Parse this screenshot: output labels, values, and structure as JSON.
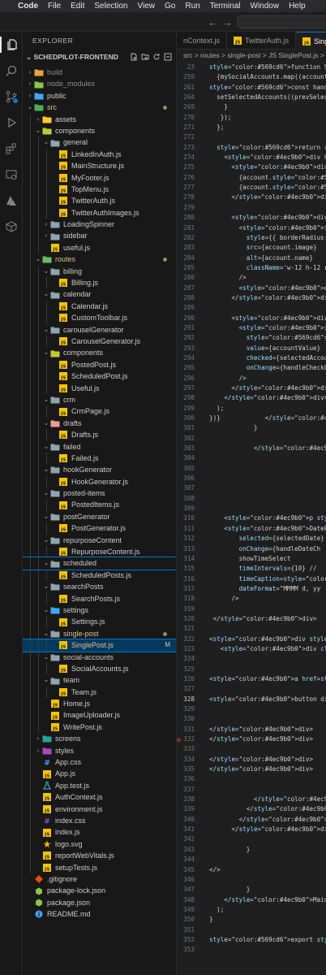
{
  "menubar": {
    "app": "Code",
    "items": [
      "File",
      "Edit",
      "Selection",
      "View",
      "Go",
      "Run",
      "Terminal",
      "Window",
      "Help"
    ]
  },
  "explorer": {
    "title": "EXPLORER",
    "root": "SCHEDPILOT-FRONTEND",
    "tree": [
      {
        "label": "build",
        "depth": 1,
        "type": "folder",
        "open": false,
        "dim": true,
        "icon": "folder-build",
        "color": "#e8a33d"
      },
      {
        "label": "node_modules",
        "depth": 1,
        "type": "folder",
        "open": false,
        "dim": true,
        "icon": "folder-node",
        "color": "#8bc34a"
      },
      {
        "label": "public",
        "depth": 1,
        "type": "folder",
        "open": false,
        "icon": "folder-public",
        "color": "#42a5f5"
      },
      {
        "label": "src",
        "depth": 1,
        "type": "folder",
        "open": true,
        "mod": true,
        "dot": true,
        "icon": "folder-src",
        "color": "#4caf50"
      },
      {
        "label": "assets",
        "depth": 2,
        "type": "folder",
        "open": false,
        "icon": "folder-assets",
        "color": "#ffca28"
      },
      {
        "label": "components",
        "depth": 2,
        "type": "folder",
        "open": true,
        "icon": "folder-components",
        "color": "#c0ca33"
      },
      {
        "label": "general",
        "depth": 3,
        "type": "folder",
        "open": true,
        "icon": "folder",
        "color": "#90a4ae"
      },
      {
        "label": "LinkedInAuth.js",
        "depth": 4,
        "type": "file",
        "icon": "js",
        "color": "#f5c400"
      },
      {
        "label": "MainStructure.js",
        "depth": 4,
        "type": "file",
        "icon": "js",
        "color": "#f5c400"
      },
      {
        "label": "MyFooter.js",
        "depth": 4,
        "type": "file",
        "icon": "js",
        "color": "#f5c400"
      },
      {
        "label": "TopMenu.js",
        "depth": 4,
        "type": "file",
        "icon": "js",
        "color": "#f5c400"
      },
      {
        "label": "TwitterAuth.js",
        "depth": 4,
        "type": "file",
        "icon": "js",
        "color": "#f5c400"
      },
      {
        "label": "TwitterAuthImages.js",
        "depth": 4,
        "type": "file",
        "icon": "js",
        "color": "#f5c400"
      },
      {
        "label": "LoadingSpinner",
        "depth": 3,
        "type": "folder",
        "open": false,
        "icon": "folder",
        "color": "#90a4ae"
      },
      {
        "label": "sidebar",
        "depth": 3,
        "type": "folder",
        "open": false,
        "icon": "folder",
        "color": "#90a4ae"
      },
      {
        "label": "useful.js",
        "depth": 3,
        "type": "file",
        "icon": "js",
        "color": "#f5c400"
      },
      {
        "label": "routes",
        "depth": 2,
        "type": "folder",
        "open": true,
        "mod": true,
        "dot": true,
        "icon": "folder-routes",
        "color": "#66bb6a"
      },
      {
        "label": "billing",
        "depth": 3,
        "type": "folder",
        "open": true,
        "icon": "folder",
        "color": "#90a4ae"
      },
      {
        "label": "Billing.js",
        "depth": 4,
        "type": "file",
        "icon": "js",
        "color": "#f5c400"
      },
      {
        "label": "calendar",
        "depth": 3,
        "type": "folder",
        "open": true,
        "icon": "folder",
        "color": "#90a4ae"
      },
      {
        "label": "Calendar.js",
        "depth": 4,
        "type": "file",
        "icon": "js",
        "color": "#f5c400"
      },
      {
        "label": "CustomToolbar.js",
        "depth": 4,
        "type": "file",
        "icon": "js",
        "color": "#f5c400"
      },
      {
        "label": "carouselGenerator",
        "depth": 3,
        "type": "folder",
        "open": true,
        "icon": "folder",
        "color": "#90a4ae"
      },
      {
        "label": "CarouselGenerator.js",
        "depth": 4,
        "type": "file",
        "icon": "js",
        "color": "#f5c400"
      },
      {
        "label": "components",
        "depth": 3,
        "type": "folder",
        "open": true,
        "icon": "folder-components",
        "color": "#c0ca33"
      },
      {
        "label": "PostedPost.js",
        "depth": 4,
        "type": "file",
        "icon": "js",
        "color": "#f5c400"
      },
      {
        "label": "ScheduledPost.js",
        "depth": 4,
        "type": "file",
        "icon": "js",
        "color": "#f5c400"
      },
      {
        "label": "Useful.js",
        "depth": 4,
        "type": "file",
        "icon": "js",
        "color": "#f5c400"
      },
      {
        "label": "crm",
        "depth": 3,
        "type": "folder",
        "open": true,
        "icon": "folder",
        "color": "#90a4ae"
      },
      {
        "label": "CrmPage.js",
        "depth": 4,
        "type": "file",
        "icon": "js",
        "color": "#f5c400"
      },
      {
        "label": "drafts",
        "depth": 3,
        "type": "folder",
        "open": true,
        "icon": "folder-drafts",
        "color": "#ef9a9a"
      },
      {
        "label": "Drafts.js",
        "depth": 4,
        "type": "file",
        "icon": "js",
        "color": "#f5c400"
      },
      {
        "label": "failed",
        "depth": 3,
        "type": "folder",
        "open": true,
        "icon": "folder",
        "color": "#90a4ae"
      },
      {
        "label": "Failed.js",
        "depth": 4,
        "type": "file",
        "icon": "js",
        "color": "#f5c400"
      },
      {
        "label": "hookGenerator",
        "depth": 3,
        "type": "folder",
        "open": true,
        "icon": "folder",
        "color": "#90a4ae"
      },
      {
        "label": "HookGenerator.js",
        "depth": 4,
        "type": "file",
        "icon": "js",
        "color": "#f5c400"
      },
      {
        "label": "posted-items",
        "depth": 3,
        "type": "folder",
        "open": true,
        "icon": "folder",
        "color": "#90a4ae"
      },
      {
        "label": "PostedItems.js",
        "depth": 4,
        "type": "file",
        "icon": "js",
        "color": "#f5c400"
      },
      {
        "label": "postGenerator",
        "depth": 3,
        "type": "folder",
        "open": true,
        "icon": "folder",
        "color": "#90a4ae"
      },
      {
        "label": "PostGenerator.js",
        "depth": 4,
        "type": "file",
        "icon": "js",
        "color": "#f5c400"
      },
      {
        "label": "repurposeContent",
        "depth": 3,
        "type": "folder",
        "open": true,
        "icon": "folder",
        "color": "#90a4ae"
      },
      {
        "label": "RepurposeContent.js",
        "depth": 4,
        "type": "file",
        "icon": "js",
        "color": "#f5c400"
      },
      {
        "label": "scheduled",
        "depth": 3,
        "type": "folder",
        "open": true,
        "focus": true,
        "icon": "folder",
        "color": "#90a4ae"
      },
      {
        "label": "ScheduledPosts.js",
        "depth": 4,
        "type": "file",
        "icon": "js",
        "color": "#f5c400"
      },
      {
        "label": "searchPosts",
        "depth": 3,
        "type": "folder",
        "open": true,
        "icon": "folder",
        "color": "#90a4ae"
      },
      {
        "label": "SearchPosts.js",
        "depth": 4,
        "type": "file",
        "icon": "js",
        "color": "#f5c400"
      },
      {
        "label": "settings",
        "depth": 3,
        "type": "folder",
        "open": true,
        "icon": "folder-settings",
        "color": "#42a5f5"
      },
      {
        "label": "Settings.js",
        "depth": 4,
        "type": "file",
        "icon": "js",
        "color": "#f5c400"
      },
      {
        "label": "single-post",
        "depth": 3,
        "type": "folder",
        "open": true,
        "mod": true,
        "dot": true,
        "icon": "folder",
        "color": "#90a4ae"
      },
      {
        "label": "SinglePost.js",
        "depth": 4,
        "type": "file",
        "mod": true,
        "selected": true,
        "badge": "M",
        "icon": "js",
        "color": "#f5c400"
      },
      {
        "label": "social-accounts",
        "depth": 3,
        "type": "folder",
        "open": true,
        "icon": "folder",
        "color": "#90a4ae"
      },
      {
        "label": "SocialAccounts.js",
        "depth": 4,
        "type": "file",
        "icon": "js",
        "color": "#f5c400"
      },
      {
        "label": "team",
        "depth": 3,
        "type": "folder",
        "open": true,
        "icon": "folder",
        "color": "#90a4ae"
      },
      {
        "label": "Team.js",
        "depth": 4,
        "type": "file",
        "icon": "js",
        "color": "#f5c400"
      },
      {
        "label": "Home.js",
        "depth": 3,
        "type": "file",
        "icon": "js",
        "color": "#f5c400"
      },
      {
        "label": "ImageUploader.js",
        "depth": 3,
        "type": "file",
        "icon": "js",
        "color": "#f5c400"
      },
      {
        "label": "WritePost.js",
        "depth": 3,
        "type": "file",
        "icon": "js",
        "color": "#f5c400"
      },
      {
        "label": "screens",
        "depth": 2,
        "type": "folder",
        "open": false,
        "icon": "folder-screens",
        "color": "#26a69a"
      },
      {
        "label": "styles",
        "depth": 2,
        "type": "folder",
        "open": false,
        "icon": "folder-styles",
        "color": "#ab47bc"
      },
      {
        "label": "App.css",
        "depth": 2,
        "type": "file",
        "icon": "css",
        "color": "#42a5f5"
      },
      {
        "label": "App.js",
        "depth": 2,
        "type": "file",
        "icon": "js",
        "color": "#f5c400"
      },
      {
        "label": "App.test.js",
        "depth": 2,
        "type": "file",
        "icon": "test",
        "color": "#26c6da"
      },
      {
        "label": "AuthContext.js",
        "depth": 2,
        "type": "file",
        "icon": "js",
        "color": "#f5c400"
      },
      {
        "label": "environment.js",
        "depth": 2,
        "type": "file",
        "icon": "js",
        "color": "#f5c400"
      },
      {
        "label": "index.css",
        "depth": 2,
        "type": "file",
        "icon": "css",
        "color": "#7e57c2"
      },
      {
        "label": "index.js",
        "depth": 2,
        "type": "file",
        "icon": "js",
        "color": "#f5c400"
      },
      {
        "label": "logo.svg",
        "depth": 2,
        "type": "file",
        "icon": "svg",
        "color": "#ffb300"
      },
      {
        "label": "reportWebVitals.js",
        "depth": 2,
        "type": "file",
        "icon": "js",
        "color": "#f5c400"
      },
      {
        "label": "setupTests.js",
        "depth": 2,
        "type": "file",
        "icon": "js",
        "color": "#f5c400"
      },
      {
        "label": ".gitignore",
        "depth": 1,
        "type": "file",
        "icon": "git",
        "color": "#e64a19"
      },
      {
        "label": "package-lock.json",
        "depth": 1,
        "type": "file",
        "icon": "npm",
        "color": "#8bc34a"
      },
      {
        "label": "package.json",
        "depth": 1,
        "type": "file",
        "icon": "npm",
        "color": "#8bc34a"
      },
      {
        "label": "README.md",
        "depth": 1,
        "type": "file",
        "icon": "info",
        "color": "#42a5f5"
      }
    ]
  },
  "tabs": [
    {
      "label": "nContext.js",
      "icon": "",
      "active": false
    },
    {
      "label": "TwitterAuth.js",
      "icon": "js",
      "active": false
    },
    {
      "label": "SinglePost.js",
      "icon": "js",
      "active": true
    }
  ],
  "breadcrumbs": "src > routes > single-post > JS SinglePost.js > ...",
  "code": {
    "current_line": "328",
    "breakpoint_line": "332",
    "lines": [
      {
        "n": "23",
        "t": "function SinglePost() {"
      },
      {
        "n": "259",
        "t": "  {mySocialAccounts.map((account) => ("
      },
      {
        "n": "261",
        "t": "const handleCheckboxChange = (e) => {"
      },
      {
        "n": "264",
        "t": "  setSelectedAccounts((prevSelected) =>"
      },
      {
        "n": "269",
        "t": "    }"
      },
      {
        "n": "270",
        "t": "   });"
      },
      {
        "n": "271",
        "t": "  };"
      },
      {
        "n": "272",
        "t": ""
      },
      {
        "n": "273",
        "t": "  return ("
      },
      {
        "n": "274",
        "t": "    <div key={account.id} className="
      },
      {
        "n": "275",
        "t": "      <div className='text-sm fo"
      },
      {
        "n": "276",
        "t": "        {account.type === \"twitte"
      },
      {
        "n": "277",
        "t": "        {account.type === \"linked"
      },
      {
        "n": "278",
        "t": "      </div>"
      },
      {
        "n": "279",
        "t": ""
      },
      {
        "n": "280",
        "t": "      <div className='d-flex mb-2"
      },
      {
        "n": "281",
        "t": "        <img"
      },
      {
        "n": "282",
        "t": "          style={{ borderRadius: '"
      },
      {
        "n": "283",
        "t": "          src={account.image}"
      },
      {
        "n": "284",
        "t": "          alt={account.name}"
      },
      {
        "n": "285",
        "t": "          className='w-12 h-12 ro"
      },
      {
        "n": "286",
        "t": "        />"
      },
      {
        "n": "287",
        "t": "        <div className='font-semi"
      },
      {
        "n": "288",
        "t": "      </div>"
      },
      {
        "n": "289",
        "t": ""
      },
      {
        "n": "290",
        "t": "      <div>"
      },
      {
        "n": "291",
        "t": "        <input"
      },
      {
        "n": "292",
        "t": "          type='checkbox'"
      },
      {
        "n": "293",
        "t": "          value={accountValue}"
      },
      {
        "n": "294",
        "t": "          checked={selectedAccoun"
      },
      {
        "n": "295",
        "t": "          onChange={handleCheckbo"
      },
      {
        "n": "296",
        "t": "        />"
      },
      {
        "n": "297",
        "t": "      </div>"
      },
      {
        "n": "298",
        "t": "    </div>"
      },
      {
        "n": "299",
        "t": "  );"
      },
      {
        "n": "300",
        "t": "})}            </div>"
      },
      {
        "n": "301",
        "t": "            }"
      },
      {
        "n": "302",
        "t": ""
      },
      {
        "n": "303",
        "t": "            </div>"
      },
      {
        "n": "304",
        "t": ""
      },
      {
        "n": "305",
        "t": ""
      },
      {
        "n": "306",
        "t": ""
      },
      {
        "n": "307",
        "t": ""
      },
      {
        "n": "308",
        "t": ""
      },
      {
        "n": "309",
        "t": ""
      },
      {
        "n": "310",
        "t": "    <p style={{fontWeight:\"bold"
      },
      {
        "n": "311",
        "t": "    <DatePicker"
      },
      {
        "n": "312",
        "t": "        selected={selectedDate}"
      },
      {
        "n": "313",
        "t": "        onChange={handleDateCh"
      },
      {
        "n": "314",
        "t": "        showTimeSelect"
      },
      {
        "n": "315",
        "t": "        timeIntervals={10} //"
      },
      {
        "n": "316",
        "t": "        timeCaption=\"Time\""
      },
      {
        "n": "317",
        "t": "        dateFormat=\"MMMM d, yy"
      },
      {
        "n": "318",
        "t": "      />"
      },
      {
        "n": "319",
        "t": ""
      },
      {
        "n": "320",
        "t": " </div>"
      },
      {
        "n": "321",
        "t": ""
      },
      {
        "n": "322",
        "t": "<div style={{background:\"rgb(24"
      },
      {
        "n": "323",
        "t": "   <div className='d-flex just"
      },
      {
        "n": "324",
        "t": ""
      },
      {
        "n": "325",
        "t": ""
      },
      {
        "n": "326",
        "t": "<a href=\"\" className='text-dange"
      },
      {
        "n": "327",
        "t": ""
      },
      {
        "n": "328",
        "t": "<button disabled={post.posted ="
      },
      {
        "n": "329",
        "t": ""
      },
      {
        "n": "330",
        "t": ""
      },
      {
        "n": "331",
        "t": "</div>"
      },
      {
        "n": "332",
        "t": "</div>"
      },
      {
        "n": "333",
        "t": ""
      },
      {
        "n": "334",
        "t": "</div>"
      },
      {
        "n": "335",
        "t": "</div>"
      },
      {
        "n": "336",
        "t": ""
      },
      {
        "n": "337",
        "t": ""
      },
      {
        "n": "338",
        "t": "            </div>"
      },
      {
        "n": "339",
        "t": "          </div>"
      },
      {
        "n": "340",
        "t": "        </div>"
      },
      {
        "n": "341",
        "t": "      </div>"
      },
      {
        "n": "342",
        "t": ""
      },
      {
        "n": "343",
        "t": "          }"
      },
      {
        "n": "344",
        "t": ""
      },
      {
        "n": "345",
        "t": "</>"
      },
      {
        "n": "346",
        "t": ""
      },
      {
        "n": "347",
        "t": "          }"
      },
      {
        "n": "348",
        "t": "    </MainStructure>"
      },
      {
        "n": "349",
        "t": "  );"
      },
      {
        "n": "350",
        "t": "}"
      },
      {
        "n": "351",
        "t": ""
      },
      {
        "n": "352",
        "t": "export default SinglePost;"
      },
      {
        "n": "353",
        "t": ""
      }
    ]
  },
  "colors": {
    "accent": "#0078d4",
    "modified": "#e2c08d",
    "selection": "#04395e"
  }
}
